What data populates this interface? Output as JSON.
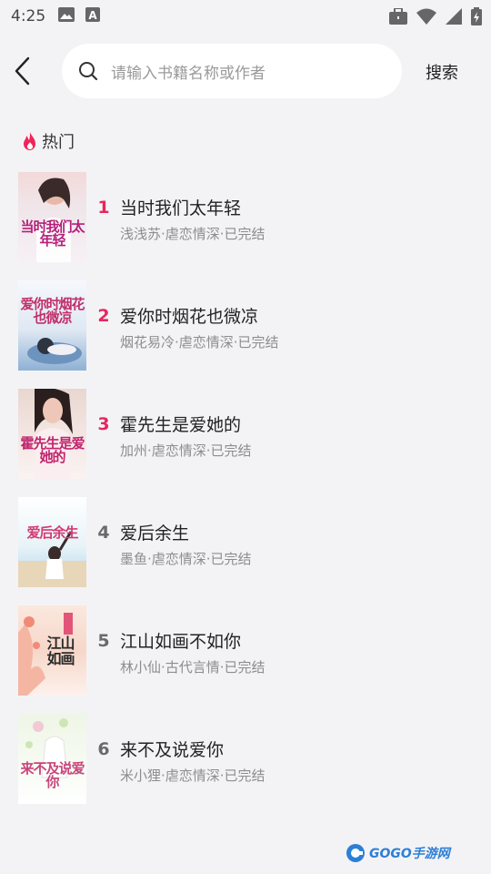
{
  "status_bar": {
    "time": "4:25",
    "icons": [
      "image-icon",
      "text-a-icon",
      "briefcase-icon",
      "wifi-icon",
      "signal-icon",
      "battery-icon"
    ]
  },
  "header": {
    "search_placeholder": "请输入书籍名称或作者",
    "search_button": "搜索"
  },
  "section": {
    "title": "热门",
    "icon": "flame-icon",
    "accent_color": "#e8265f"
  },
  "books": [
    {
      "rank": "1",
      "title": "当时我们太年轻",
      "meta": "浅浅苏·虐恋情深·已完结",
      "cover_text": "当时我们太年轻",
      "hot": true
    },
    {
      "rank": "2",
      "title": "爱你时烟花也微凉",
      "meta": "烟花易冷·虐恋情深·已完结",
      "cover_text": "爱你时烟花也微凉",
      "hot": true
    },
    {
      "rank": "3",
      "title": "霍先生是爱她的",
      "meta": "加州·虐恋情深·已完结",
      "cover_text": "霍先生是爱她的",
      "hot": true
    },
    {
      "rank": "4",
      "title": "爱后余生",
      "meta": "墨鱼·虐恋情深·已完结",
      "cover_text": "爱后余生",
      "hot": false
    },
    {
      "rank": "5",
      "title": "江山如画不如你",
      "meta": "林小仙·古代言情·已完结",
      "cover_text": "江山如画",
      "hot": false
    },
    {
      "rank": "6",
      "title": "来不及说爱你",
      "meta": "米小狸·虐恋情深·已完结",
      "cover_text": "来不及说爱你",
      "hot": false
    }
  ],
  "watermark": {
    "text": "GOGO手游网"
  }
}
